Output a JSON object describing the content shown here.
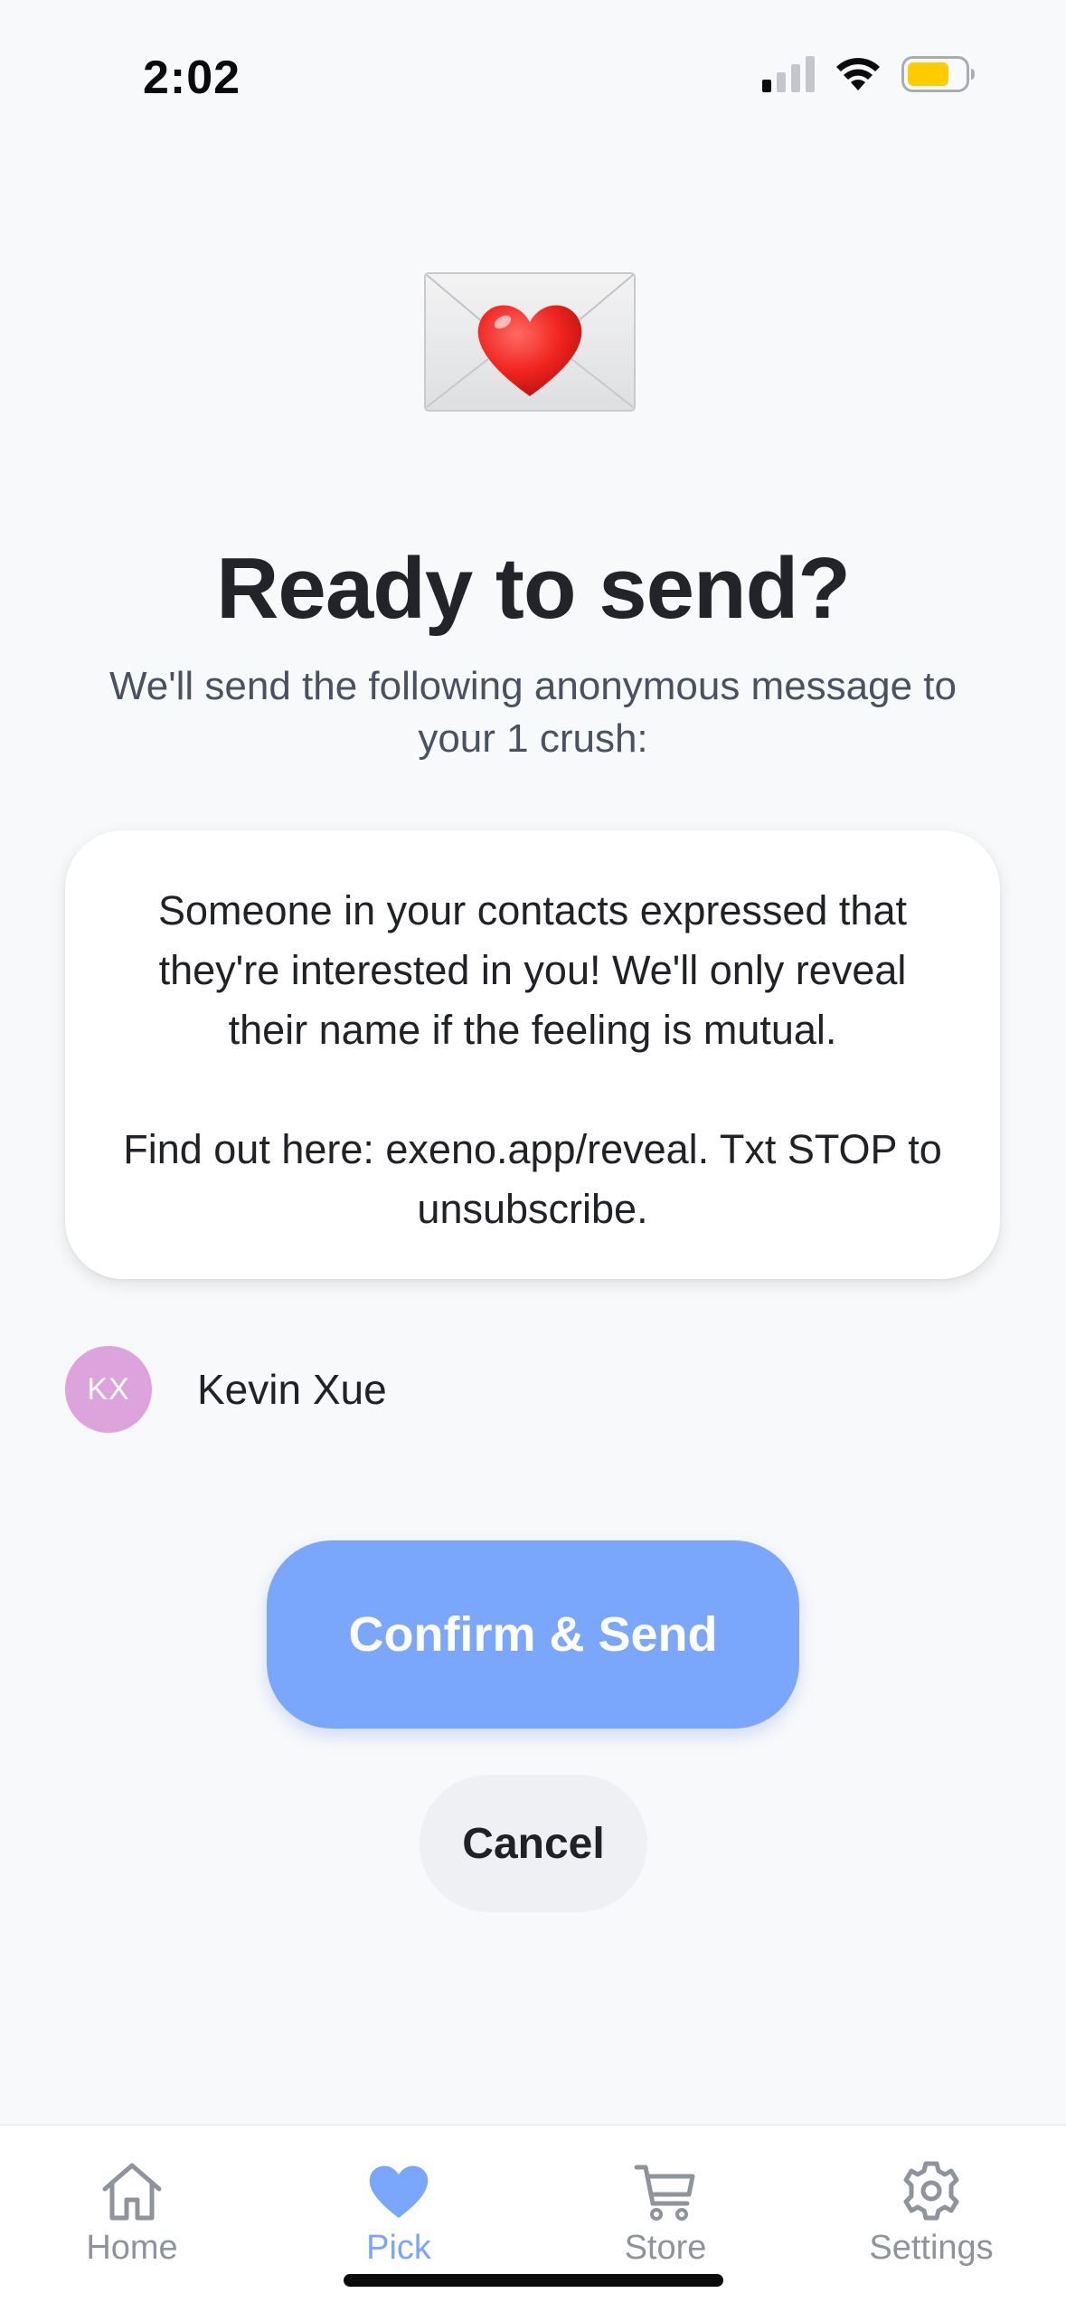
{
  "status_bar": {
    "time": "2:02",
    "battery_color": "#ffcc00",
    "signal_bars_active": 1
  },
  "header": {
    "icon": "love-letter-icon",
    "title": "Ready to send?",
    "subtitle": "We'll send the following anonymous message to your 1 crush:"
  },
  "message": {
    "paragraph_1": "Someone in your contacts expressed that they're interested in you! We'll only reveal their name if the feeling is mutual.",
    "paragraph_2": "Find out here: exeno.app/reveal. Txt STOP to unsubscribe."
  },
  "recipient": {
    "initials": "KX",
    "name": "Kevin Xue",
    "avatar_color": "#dda3dc"
  },
  "actions": {
    "confirm_label": "Confirm & Send",
    "cancel_label": "Cancel",
    "accent_color": "#7aa6fc"
  },
  "tab_bar": {
    "tabs": [
      {
        "label": "Home",
        "icon": "home-icon",
        "active": false
      },
      {
        "label": "Pick",
        "icon": "heart-icon",
        "active": true
      },
      {
        "label": "Store",
        "icon": "cart-icon",
        "active": false
      },
      {
        "label": "Settings",
        "icon": "gear-icon",
        "active": false
      }
    ]
  }
}
